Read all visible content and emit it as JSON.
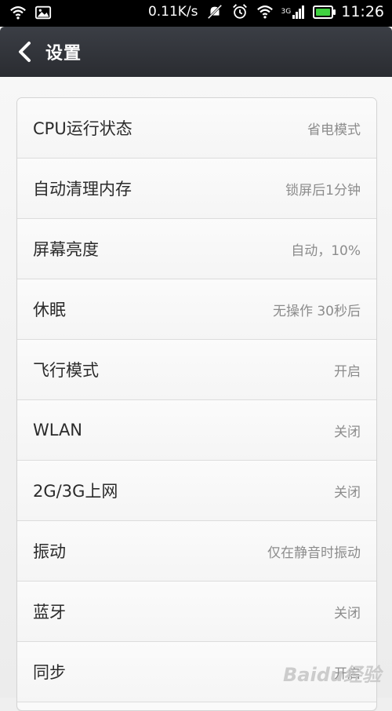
{
  "status_bar": {
    "net_speed": "0.11K/s",
    "network_label": "3G",
    "time": "11:26",
    "icons": [
      "wifi-icon",
      "image-notification-icon",
      "no-notification-icon",
      "alarm-icon",
      "wifi-icon",
      "signal-icon",
      "battery-icon"
    ]
  },
  "header": {
    "title": "设置"
  },
  "settings": [
    {
      "label": "CPU运行状态",
      "value": "省电模式"
    },
    {
      "label": "自动清理内存",
      "value": "锁屏后1分钟"
    },
    {
      "label": "屏幕亮度",
      "value": "自动，10%"
    },
    {
      "label": "休眠",
      "value": "无操作 30秒后"
    },
    {
      "label": "飞行模式",
      "value": "开启"
    },
    {
      "label": "WLAN",
      "value": "关闭"
    },
    {
      "label": "2G/3G上网",
      "value": "关闭"
    },
    {
      "label": "振动",
      "value": "仅在静音时振动"
    },
    {
      "label": "蓝牙",
      "value": "关闭"
    },
    {
      "label": "同步",
      "value": "开启"
    }
  ],
  "watermark": "Baidu经验",
  "colors": {
    "status_bar_bg": "#000000",
    "title_bar_bg": "#33363c",
    "battery_green": "#3fd13f",
    "label_text": "#2b2b2b",
    "value_text": "#8c8c8c"
  }
}
